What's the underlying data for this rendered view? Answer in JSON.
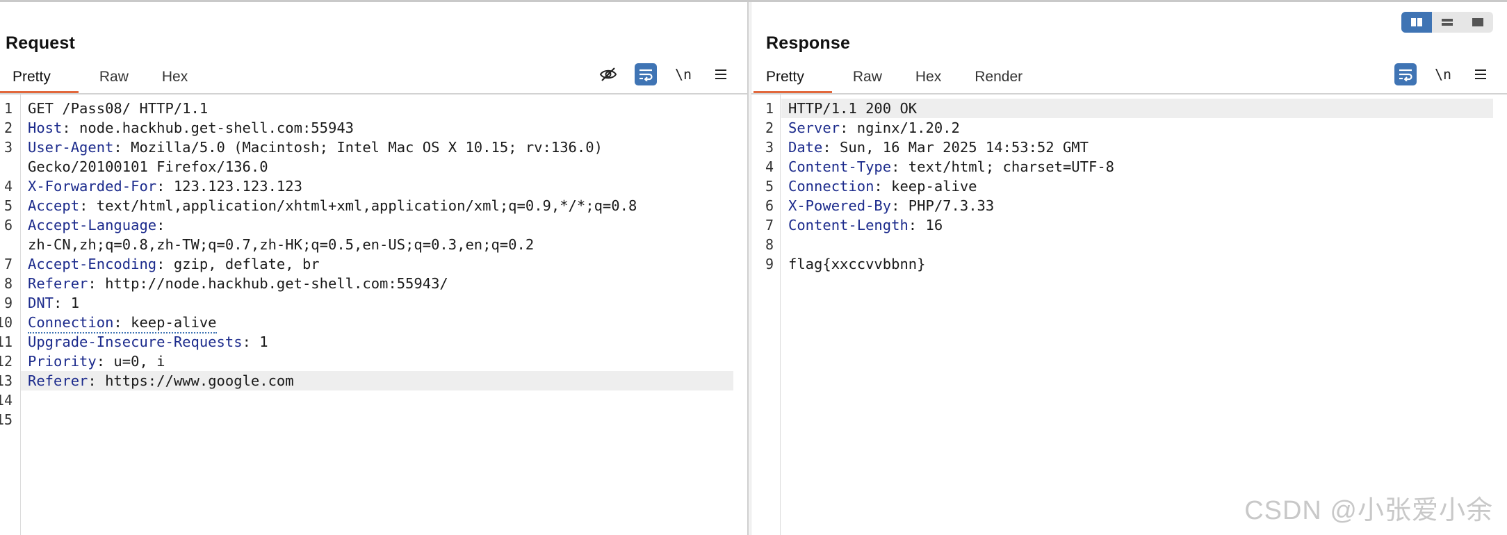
{
  "request": {
    "title": "Request",
    "tabs": [
      "Pretty",
      "Raw",
      "Hex"
    ],
    "active_tab": "Pretty",
    "toolbar": {
      "newline": "\\n"
    },
    "lines": [
      {
        "n": "1",
        "key": "",
        "val": "GET /Pass08/ HTTP/1.1"
      },
      {
        "n": "2",
        "key": "Host",
        "val": ": node.hackhub.get-shell.com:55943"
      },
      {
        "n": "3",
        "key": "User-Agent",
        "val": ": Mozilla/5.0 (Macintosh; Intel Mac OS X 10.15; rv:136.0)\nGecko/20100101 Firefox/136.0"
      },
      {
        "n": "4",
        "key": "X-Forwarded-For",
        "val": ": 123.123.123.123"
      },
      {
        "n": "5",
        "key": "Accept",
        "val": ": text/html,application/xhtml+xml,application/xml;q=0.9,*/*;q=0.8"
      },
      {
        "n": "6",
        "key": "Accept-Language",
        "val": ":\nzh-CN,zh;q=0.8,zh-TW;q=0.7,zh-HK;q=0.5,en-US;q=0.3,en;q=0.2"
      },
      {
        "n": "7",
        "key": "Accept-Encoding",
        "val": ": gzip, deflate, br"
      },
      {
        "n": "8",
        "key": "Referer",
        "val": ": http://node.hackhub.get-shell.com:55943/"
      },
      {
        "n": "9",
        "key": "DNT",
        "val": ": 1"
      },
      {
        "n": "10",
        "key": "Connection",
        "val": ": keep-alive"
      },
      {
        "n": "11",
        "key": "Upgrade-Insecure-Requests",
        "val": ": 1"
      },
      {
        "n": "12",
        "key": "Priority",
        "val": ": u=0, i"
      },
      {
        "n": "13",
        "key": "Referer",
        "val": ": https://www.google.com"
      },
      {
        "n": "14",
        "key": "",
        "val": ""
      },
      {
        "n": "15",
        "key": "",
        "val": ""
      }
    ]
  },
  "response": {
    "title": "Response",
    "tabs": [
      "Pretty",
      "Raw",
      "Hex",
      "Render"
    ],
    "active_tab": "Pretty",
    "toolbar": {
      "newline": "\\n"
    },
    "lines": [
      {
        "n": "1",
        "key": "",
        "val": "HTTP/1.1 200 OK"
      },
      {
        "n": "2",
        "key": "Server",
        "val": ": nginx/1.20.2"
      },
      {
        "n": "3",
        "key": "Date",
        "val": ": Sun, 16 Mar 2025 14:53:52 GMT"
      },
      {
        "n": "4",
        "key": "Content-Type",
        "val": ": text/html; charset=UTF-8"
      },
      {
        "n": "5",
        "key": "Connection",
        "val": ": keep-alive"
      },
      {
        "n": "6",
        "key": "X-Powered-By",
        "val": ": PHP/7.3.33"
      },
      {
        "n": "7",
        "key": "Content-Length",
        "val": ": 16"
      },
      {
        "n": "8",
        "key": "",
        "val": ""
      },
      {
        "n": "9",
        "key": "",
        "val": "flag{xxccvvbbnn}"
      }
    ]
  },
  "watermark": "CSDN @小张爱小余",
  "colors": {
    "accent": "#e2683c",
    "active_button": "#3f74b4",
    "header_key": "#1c2b8c"
  },
  "icons": {
    "request_toolbar": [
      "eye-off-icon",
      "wrap-lines-icon",
      "newline-icon",
      "menu-icon"
    ],
    "response_toolbar": [
      "wrap-lines-icon",
      "newline-icon",
      "menu-icon"
    ],
    "layout_switch": [
      "split-horizontal-icon",
      "split-vertical-icon",
      "single-pane-icon"
    ]
  }
}
